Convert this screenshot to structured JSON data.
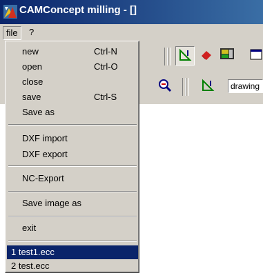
{
  "window": {
    "title": "CAMConcept milling - []"
  },
  "menubar": {
    "file": "file",
    "help": "?"
  },
  "toolbar": {
    "drawing_select": "drawing"
  },
  "file_menu": {
    "new": {
      "label": "new",
      "shortcut": "Ctrl-N"
    },
    "open": {
      "label": "open",
      "shortcut": "Ctrl-O"
    },
    "close": {
      "label": "close"
    },
    "save": {
      "label": "save",
      "shortcut": "Ctrl-S"
    },
    "save_as": {
      "label": "Save as"
    },
    "dxf_import": {
      "label": "DXF import"
    },
    "dxf_export": {
      "label": "DXF export"
    },
    "nc_export": {
      "label": "NC-Export"
    },
    "save_image_as": {
      "label": "Save image as"
    },
    "exit": {
      "label": "exit"
    },
    "recent": [
      {
        "label": "1 test1.ecc"
      },
      {
        "label": "2 test.ecc"
      }
    ]
  }
}
